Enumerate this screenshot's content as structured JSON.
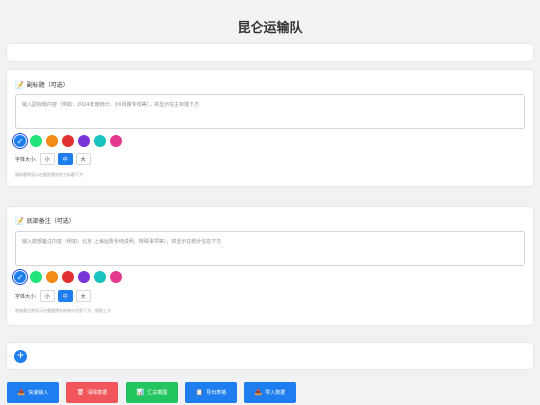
{
  "page": {
    "title": "昆仑运输队"
  },
  "subtitle": {
    "label": "副标题（可选）",
    "label_icon": "memo-icon",
    "placeholder": "输入副标题内容（例如：2024年度统计、XX线路专线等），将显示在主标题下方",
    "font_size_label": "字体大小:",
    "sizes": [
      "小",
      "中",
      "大"
    ],
    "selected_size": "中",
    "hint": "副标题将显示在截图预览的主标题下方"
  },
  "footer_note": {
    "label": "底部备注（可选）",
    "label_icon": "memo-icon",
    "placeholder": "输入底部备注内容（例如：北京-上海运费专线说明、特殊事项等），将显示在统计信息下方",
    "font_size_label": "字体大小:",
    "sizes": [
      "小",
      "中",
      "大"
    ],
    "selected_size": "中",
    "hint": "底部备注将显示在截图预览的统计信息下方、版权上方"
  },
  "palette": [
    "#1e7ef0",
    "#22e37a",
    "#f28a16",
    "#e23131",
    "#7a35d8",
    "#19c4bf",
    "#e5398e"
  ],
  "selected_color": "#1e7ef0",
  "add_button": {
    "label": "+"
  },
  "actions": [
    {
      "label": "快速输入",
      "icon": "inbox-icon",
      "glyph": "📥",
      "color": "#1e7ef0"
    },
    {
      "label": "清除数据",
      "icon": "trash-icon",
      "glyph": "🗑",
      "color": "#f0565a"
    },
    {
      "label": "汇总截图",
      "icon": "chart-icon",
      "glyph": "📊",
      "color": "#22c55e"
    },
    {
      "label": "导出表格",
      "icon": "clipboard-icon",
      "glyph": "📋",
      "color": "#1e7ef0"
    },
    {
      "label": "导入数据",
      "icon": "download-icon",
      "glyph": "📥",
      "color": "#1e7ef0"
    }
  ]
}
